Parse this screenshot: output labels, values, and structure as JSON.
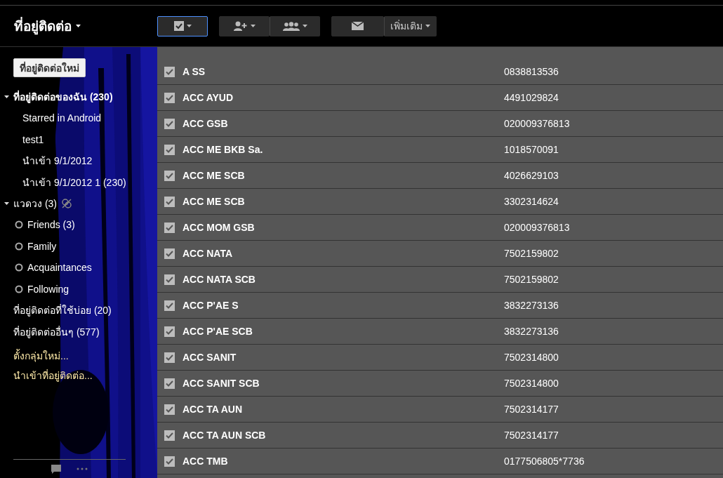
{
  "header": {
    "title": "ที่อยู่ติดต่อ",
    "toolbar": [
      {
        "kind": "select",
        "focused": true
      },
      {
        "kind": "add-person"
      },
      {
        "kind": "group"
      },
      {
        "kind": "mail"
      },
      {
        "kind": "more",
        "label": "เพิ่มเติม"
      }
    ]
  },
  "sidebar": {
    "new_button": "ที่อยู่ติดต่อใหม่",
    "tree": [
      {
        "kind": "section",
        "label": "ที่อยู่ติดต่อของฉัน (230)",
        "expanded": true,
        "children": [
          {
            "label": "Starred in Android"
          },
          {
            "label": "test1"
          },
          {
            "label": "นำเข้า 9/1/2012"
          },
          {
            "label": "นำเข้า 9/1/2012 1 (230)"
          }
        ]
      },
      {
        "kind": "circles",
        "label": "แวดวง (3)",
        "expanded": true,
        "children": [
          {
            "label": "Friends (3)"
          },
          {
            "label": "Family"
          },
          {
            "label": "Acquaintances"
          },
          {
            "label": "Following"
          }
        ]
      },
      {
        "kind": "link",
        "label": "ที่อยู่ติดต่อที่ใช้บ่อย (20)"
      },
      {
        "kind": "link",
        "label": "ที่อยู่ติดต่ออื่นๆ (577)"
      }
    ],
    "actions": [
      "ตั้งกลุ่มใหม่...",
      "นำเข้าที่อยู่ติดต่อ..."
    ]
  },
  "contacts": [
    {
      "name": "A SS",
      "phone": "0838813536",
      "checked": true
    },
    {
      "name": "ACC AYUD",
      "phone": "4491029824",
      "checked": true
    },
    {
      "name": "ACC GSB",
      "phone": "020009376813",
      "checked": true
    },
    {
      "name": "ACC ME BKB Sa.",
      "phone": "1018570091",
      "checked": true
    },
    {
      "name": "ACC ME SCB",
      "phone": "4026629103",
      "checked": true
    },
    {
      "name": "ACC ME SCB",
      "phone": "3302314624",
      "checked": true
    },
    {
      "name": "ACC MOM GSB",
      "phone": "020009376813",
      "checked": true
    },
    {
      "name": "ACC NATA",
      "phone": "7502159802",
      "checked": true
    },
    {
      "name": "ACC NATA SCB",
      "phone": "7502159802",
      "checked": true
    },
    {
      "name": "ACC P'AE S",
      "phone": "3832273136",
      "checked": true
    },
    {
      "name": "ACC P'AE SCB",
      "phone": "3832273136",
      "checked": true
    },
    {
      "name": "ACC SANIT",
      "phone": "7502314800",
      "checked": true
    },
    {
      "name": "ACC SANIT SCB",
      "phone": "7502314800",
      "checked": true
    },
    {
      "name": "ACC TA AUN",
      "phone": "7502314177",
      "checked": true
    },
    {
      "name": "ACC TA AUN SCB",
      "phone": "7502314177",
      "checked": true
    },
    {
      "name": "ACC TMB",
      "phone": "0177506805*7736",
      "checked": true
    }
  ]
}
